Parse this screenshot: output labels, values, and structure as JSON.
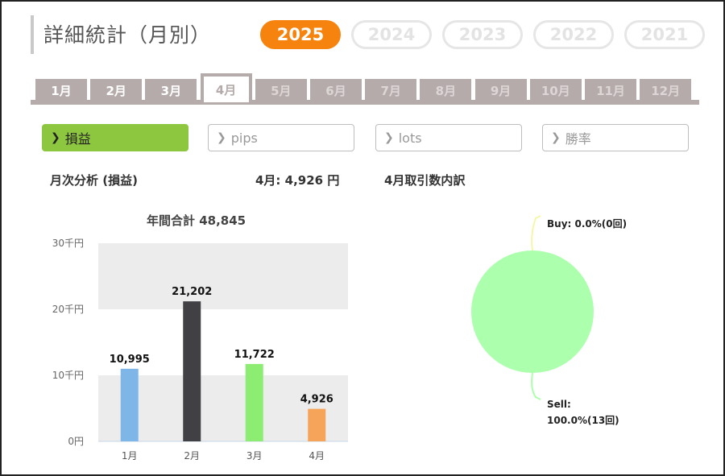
{
  "page": {
    "title": "詳細統計（月別）"
  },
  "years": [
    {
      "label": "2025",
      "active": true
    },
    {
      "label": "2024",
      "active": false
    },
    {
      "label": "2023",
      "active": false
    },
    {
      "label": "2022",
      "active": false
    },
    {
      "label": "2021",
      "active": false
    }
  ],
  "months": [
    {
      "label": "1月",
      "state": "enabled"
    },
    {
      "label": "2月",
      "state": "enabled"
    },
    {
      "label": "3月",
      "state": "enabled"
    },
    {
      "label": "4月",
      "state": "active"
    },
    {
      "label": "5月",
      "state": "disabled"
    },
    {
      "label": "6月",
      "state": "disabled"
    },
    {
      "label": "7月",
      "state": "disabled"
    },
    {
      "label": "8月",
      "state": "disabled"
    },
    {
      "label": "9月",
      "state": "disabled"
    },
    {
      "label": "10月",
      "state": "disabled"
    },
    {
      "label": "11月",
      "state": "disabled"
    },
    {
      "label": "12月",
      "state": "disabled"
    }
  ],
  "metrics": [
    {
      "label": "損益",
      "active": true
    },
    {
      "label": "pips",
      "active": false
    },
    {
      "label": "lots",
      "active": false
    },
    {
      "label": "勝率",
      "active": false
    }
  ],
  "analysis": {
    "heading": "月次分析 (損益)",
    "month_summary": "4月:  4,926 円",
    "breakdown_heading": "4月取引数内訳"
  },
  "colors": {
    "accent": "#f5830d",
    "active_metric": "#8dc63f",
    "tab": "#b6abab"
  },
  "chart_data": [
    {
      "type": "bar",
      "title": "年間合計 48,845",
      "categories": [
        "1月",
        "2月",
        "3月",
        "4月"
      ],
      "values": [
        10995,
        21202,
        11722,
        4926
      ],
      "value_labels": [
        "10,995",
        "21,202",
        "11,722",
        "4,926"
      ],
      "bar_colors": [
        "#7eb6e8",
        "#404045",
        "#8ded72",
        "#f6a45a"
      ],
      "yticks": [
        0,
        10000,
        20000,
        30000
      ],
      "ytick_labels": [
        "0円",
        "10千円",
        "20千円",
        "30千円"
      ],
      "ylim": [
        0,
        30000
      ],
      "grid": "alternating bands"
    },
    {
      "type": "pie",
      "slices": [
        {
          "name": "Buy",
          "value": 0.0,
          "count": 0,
          "label": "Buy: 0.0%(0回)",
          "color": "#f5f7a8"
        },
        {
          "name": "Sell",
          "value": 100.0,
          "count": 13,
          "label_line1": "Sell:",
          "label_line2": "100.0%(13回)",
          "color": "#acffac"
        }
      ]
    }
  ]
}
